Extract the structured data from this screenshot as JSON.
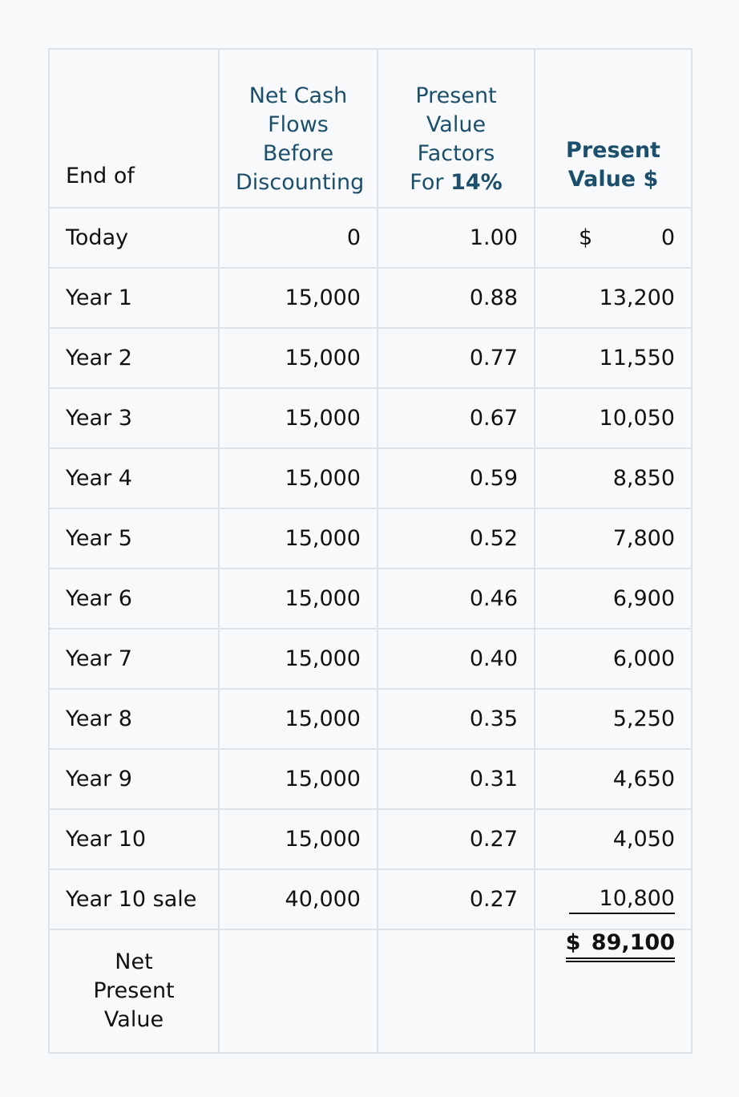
{
  "header": {
    "col1": "End of",
    "col2_line1": "Net Cash",
    "col2_line2": "Flows Before",
    "col2_line3": "Discounting",
    "col3_line1": "Present",
    "col3_line2": "Value",
    "col3_line3": "Factors",
    "col3_line4_prefix": "For",
    "col3_line4_rate": "14%",
    "col4_line1": "Present",
    "col4_line2": "Value $"
  },
  "rows": [
    {
      "label": "Today",
      "cash": "0",
      "factor": "1.00",
      "pv_symbol": "$",
      "pv": "0"
    },
    {
      "label": "Year 1",
      "cash": "15,000",
      "factor": "0.88",
      "pv": "13,200"
    },
    {
      "label": "Year 2",
      "cash": "15,000",
      "factor": "0.77",
      "pv": "11,550"
    },
    {
      "label": "Year 3",
      "cash": "15,000",
      "factor": "0.67",
      "pv": "10,050"
    },
    {
      "label": "Year 4",
      "cash": "15,000",
      "factor": "0.59",
      "pv": "8,850"
    },
    {
      "label": "Year 5",
      "cash": "15,000",
      "factor": "0.52",
      "pv": "7,800"
    },
    {
      "label": "Year 6",
      "cash": "15,000",
      "factor": "0.46",
      "pv": "6,900"
    },
    {
      "label": "Year 7",
      "cash": "15,000",
      "factor": "0.40",
      "pv": "6,000"
    },
    {
      "label": "Year 8",
      "cash": "15,000",
      "factor": "0.35",
      "pv": "5,250"
    },
    {
      "label": "Year 9",
      "cash": "15,000",
      "factor": "0.31",
      "pv": "4,650"
    },
    {
      "label": "Year 10",
      "cash": "15,000",
      "factor": "0.27",
      "pv": "4,050"
    },
    {
      "label": "Year 10 sale",
      "cash": "40,000",
      "factor": "0.27",
      "pv": "10,800"
    }
  ],
  "total": {
    "label_line1": "Net",
    "label_line2": "Present",
    "label_line3": "Value",
    "value": "$ 89,100"
  }
}
